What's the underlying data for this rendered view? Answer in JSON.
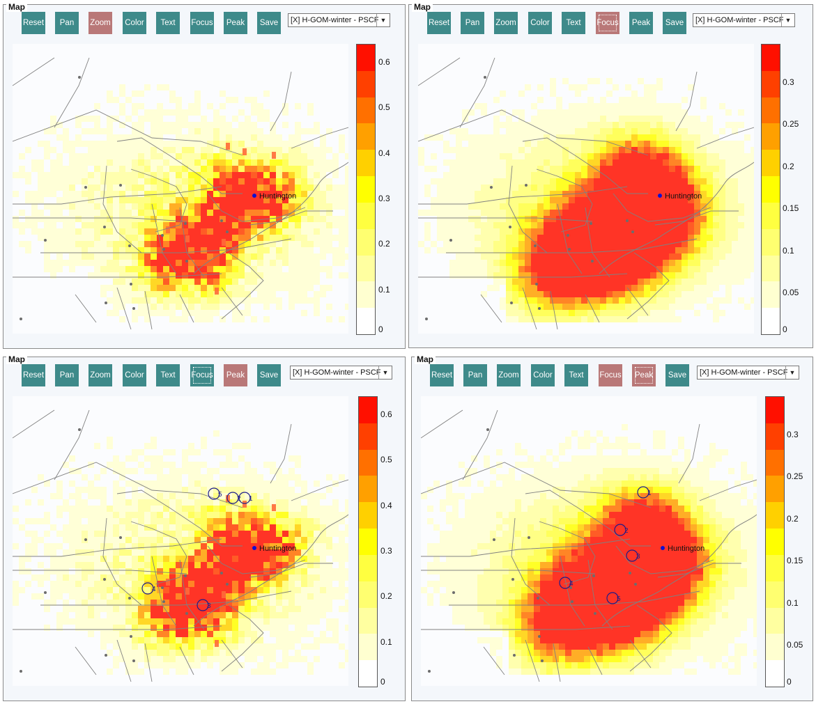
{
  "panels": [
    {
      "title": "Map",
      "buttons": [
        "Reset",
        "Pan",
        "Zoom",
        "Color",
        "Text",
        "Focus",
        "Peak",
        "Save"
      ],
      "active": [
        2
      ],
      "ring": [],
      "select": "[X] H-GOM-winter - PSCF",
      "city": "Huntington",
      "scale": {
        "ticks": [
          "0.6",
          "0.5",
          "0.4",
          "0.3",
          "0.2",
          "0.1",
          "0"
        ],
        "max": 0.64
      },
      "peaks": []
    },
    {
      "title": "Map",
      "buttons": [
        "Reset",
        "Pan",
        "Zoom",
        "Color",
        "Text",
        "Focus",
        "Peak",
        "Save"
      ],
      "active": [
        5
      ],
      "ring": [
        5
      ],
      "select": "[X] H-GOM-winter - PSCF",
      "city": "Huntington",
      "scale": {
        "ticks": [
          "0.3",
          "0.25",
          "0.2",
          "0.15",
          "0.1",
          "0.05",
          "0"
        ],
        "max": 0.345
      },
      "peaks": []
    },
    {
      "title": "Map",
      "buttons": [
        "Reset",
        "Pan",
        "Zoom",
        "Color",
        "Text",
        "Focus",
        "Peak",
        "Save"
      ],
      "active": [
        6
      ],
      "ring": [
        5
      ],
      "select": "[X] H-GOM-winter - PSCF",
      "city": "Huntington",
      "scale": {
        "ticks": [
          "0.6",
          "0.5",
          "0.4",
          "0.3",
          "0.2",
          "0.1",
          "0"
        ],
        "max": 0.64
      },
      "peaks": [
        "1",
        "2",
        "3",
        "4",
        "5"
      ]
    },
    {
      "title": "Map",
      "buttons": [
        "Reset",
        "Pan",
        "Zoom",
        "Color",
        "Text",
        "Focus",
        "Peak",
        "Save"
      ],
      "active": [
        5,
        6
      ],
      "ring": [
        6
      ],
      "select": "[X] H-GOM-winter - PSCF",
      "city": "Huntington",
      "scale": {
        "ticks": [
          "0.3",
          "0.25",
          "0.2",
          "0.15",
          "0.1",
          "0.05",
          "0"
        ],
        "max": 0.345
      },
      "peaks": [
        "1",
        "2",
        "3",
        "4",
        "5"
      ]
    }
  ],
  "colors": {
    "button": "#3e8a8a",
    "button_active": "#b97878",
    "scale": [
      "#ffffff",
      "#ffffd0",
      "#ffffa0",
      "#ffff70",
      "#ffff40",
      "#ffff00",
      "#ffd000",
      "#ffa000",
      "#ff7000",
      "#ff4000",
      "#ff1000"
    ]
  }
}
